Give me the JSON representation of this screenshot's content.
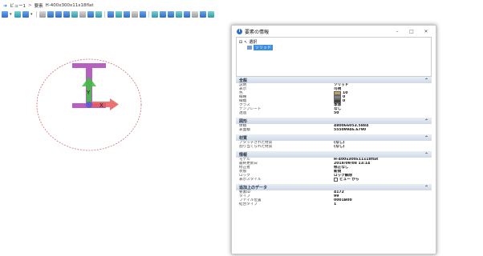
{
  "breadcrumb": {
    "items": [
      "ビュー1",
      "要素",
      "H-400x300x11x18flat"
    ]
  },
  "toolbar": {
    "buttons": [
      "new-icon",
      "open-icon",
      "save-icon",
      "print-icon",
      "zoom-icon",
      "zoom-in-icon",
      "zoom-out-icon",
      "fit-icon",
      "grid-icon",
      "snap-icon",
      "copy-icon",
      "paste-icon",
      "filter-icon",
      "layer-icon",
      "view-icon",
      "render-icon",
      "material-icon",
      "pointer-icon",
      "measure-icon",
      "section-icon",
      "light-icon",
      "camera-icon",
      "export-icon",
      "help-icon"
    ]
  },
  "viewport": {
    "axis_y": "Y",
    "axis_x": "X"
  },
  "panel": {
    "title": "要素の情報",
    "window_buttons": {
      "minimize": "–",
      "maximize": "□",
      "close": "✕"
    },
    "tree": {
      "root_label": "選択",
      "child_label": "ソリッド"
    },
    "sections": [
      {
        "name": "全般",
        "props": [
          {
            "key": "説明",
            "value": "ソリッド"
          },
          {
            "key": "表示",
            "value": "可視"
          },
          {
            "key": "色",
            "value": "10",
            "swatch": "#c0a060"
          },
          {
            "key": "線種",
            "value": "0",
            "swatch": "#808080"
          },
          {
            "key": "線幅",
            "value": "0",
            "swatch": "#404040"
          },
          {
            "key": "クラス",
            "value": "本体"
          },
          {
            "key": "テンプレート",
            "value": "なし"
          },
          {
            "key": "透過",
            "value": "50"
          }
        ]
      },
      {
        "name": "図形",
        "props": [
          {
            "key": "体積",
            "value": "480066053.5884"
          },
          {
            "key": "表面積",
            "value": "55509946.6790"
          }
        ]
      },
      {
        "name": "材質",
        "props": [
          {
            "key": "アタッチされた材質",
            "value": "(なし)"
          },
          {
            "key": "割り当てられた材質",
            "value": "(なし)"
          }
        ]
      },
      {
        "name": "情報",
        "props": [
          {
            "key": "モデル",
            "value": "H-400x300x11x18flat"
          },
          {
            "key": "最終更新日",
            "value": "2018/09/08 13:14"
          },
          {
            "key": "修正者",
            "value": "修正なし"
          },
          {
            "key": "状態",
            "value": "新規"
          },
          {
            "key": "ロック",
            "value": "ロック解除"
          },
          {
            "key": "表示スタイル",
            "value": "ビュー から",
            "checkbox": true
          }
        ]
      },
      {
        "name": "追加上のデータ",
        "props": [
          {
            "key": "要素ID",
            "value": "4172"
          },
          {
            "key": "タイプ",
            "value": "99"
          },
          {
            "key": "ファイル位置",
            "value": "0001B00"
          },
          {
            "key": "結合タイプ",
            "value": "1"
          }
        ]
      }
    ]
  }
}
